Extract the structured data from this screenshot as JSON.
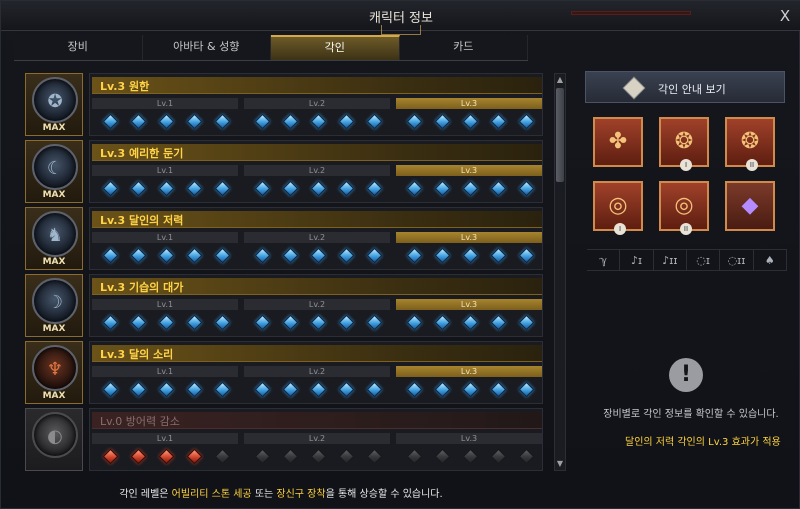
{
  "window": {
    "title": "캐릭터 정보",
    "close": "X"
  },
  "tabs": [
    {
      "label": "장비",
      "active": false
    },
    {
      "label": "아바타 & 성향",
      "active": false
    },
    {
      "label": "각인",
      "active": true
    },
    {
      "label": "카드",
      "active": false
    }
  ],
  "level_labels": [
    "Lv.1",
    "Lv.2",
    "Lv.3"
  ],
  "engravings": [
    {
      "name": "Lv.3 원한",
      "badge": "MAX",
      "level": 3,
      "icon": "grudge-icon",
      "gem_color": "blue",
      "active": true
    },
    {
      "name": "Lv.3 예리한 둔기",
      "badge": "MAX",
      "level": 3,
      "icon": "keen-blunt-weapon-icon",
      "gem_color": "blue",
      "active": true
    },
    {
      "name": "Lv.3 달인의 저력",
      "badge": "MAX",
      "level": 3,
      "icon": "master-brawler-icon",
      "gem_color": "blue",
      "active": true
    },
    {
      "name": "Lv.3 기습의 대가",
      "badge": "MAX",
      "level": 3,
      "icon": "master-of-ambush-icon",
      "gem_color": "blue",
      "active": true
    },
    {
      "name": "Lv.3 달의 소리",
      "badge": "MAX",
      "level": 3,
      "icon": "moonfall-icon",
      "gem_color": "blue",
      "active": true
    },
    {
      "name": "Lv.0 방어력 감소",
      "badge": "",
      "level": 0,
      "icon": "defense-reduction-icon",
      "gem_color": "red",
      "red_filled": 4,
      "active": false
    }
  ],
  "guide_button": {
    "label": "각인 안내 보기",
    "icon": "guide-book-icon"
  },
  "equipment_slots": [
    {
      "name": "necklace",
      "icon": "necklace-icon",
      "numeral": ""
    },
    {
      "name": "earring-1",
      "icon": "earring-icon",
      "numeral": "I"
    },
    {
      "name": "earring-2",
      "icon": "earring-icon",
      "numeral": "II"
    },
    {
      "name": "ring-1",
      "icon": "ring-icon",
      "numeral": "I"
    },
    {
      "name": "ring-2",
      "icon": "ring-icon",
      "numeral": "II"
    },
    {
      "name": "ability-stone",
      "icon": "ability-stone-icon",
      "numeral": ""
    }
  ],
  "filters": [
    {
      "name": "necklace",
      "label": "ℽ"
    },
    {
      "name": "earring-1",
      "label": "♪ɪ"
    },
    {
      "name": "earring-2",
      "label": "♪ɪɪ"
    },
    {
      "name": "ring-1",
      "label": "◌ɪ"
    },
    {
      "name": "ring-2",
      "label": "◌ɪɪ"
    },
    {
      "name": "stone",
      "label": "♠"
    }
  ],
  "side_hint": "장비별로 각인 정보를 확인할 수 있습니다.",
  "active_effect": "달인의 저력 각인의 Lv.3 효과가 적용",
  "footer": {
    "prefix": "각인 레벨은 ",
    "hl1": "어빌리티 스톤 세공",
    "mid": " 또는 ",
    "hl2": "장신구 장착",
    "suffix": "을 통해 상승할 수 있습니다."
  },
  "colors": {
    "accent_gold": "#d2aa4a",
    "highlight_text": "#ffd23d",
    "gem_blue": "#3fa0e0",
    "gem_red": "#d2452c"
  }
}
